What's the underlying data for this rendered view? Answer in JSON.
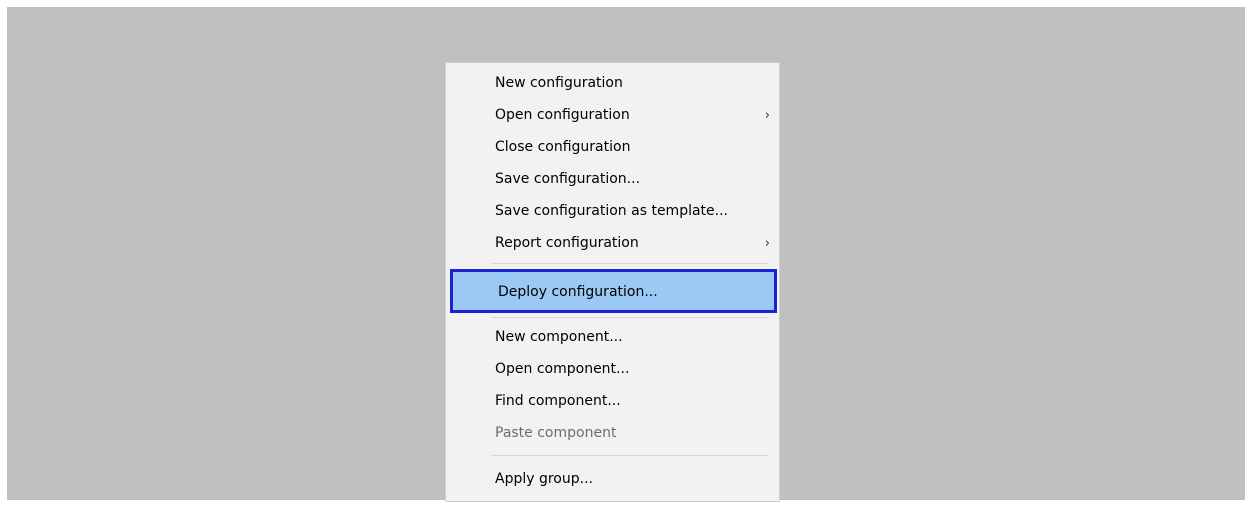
{
  "menu": {
    "items": [
      {
        "label": "New configuration"
      },
      {
        "label": "Open configuration",
        "submenu": "chevron-right-icon"
      },
      {
        "label": "Close configuration"
      },
      {
        "label": "Save configuration..."
      },
      {
        "label": "Save configuration as template..."
      },
      {
        "label": "Report configuration",
        "submenu": "chevron-right-icon"
      },
      {
        "label": "Deploy configuration...",
        "state": "selected"
      },
      {
        "label": "New component..."
      },
      {
        "label": "Open component..."
      },
      {
        "label": "Find component..."
      },
      {
        "label": "Paste component",
        "state": "disabled"
      },
      {
        "label": "Apply group..."
      }
    ],
    "chevron_glyph": "›",
    "colors": {
      "background": "#c0c0c0",
      "menu": "#f2f2f2",
      "highlight": "#9ac9f5",
      "focus_border": "#1a23d3",
      "disabled_text": "#6d6d6d"
    }
  }
}
